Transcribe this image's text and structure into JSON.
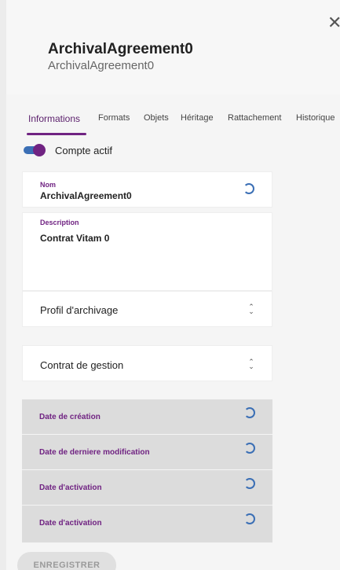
{
  "header": {
    "title": "ArchivalAgreement0",
    "subtitle": "ArchivalAgreement0"
  },
  "tabs": [
    {
      "label": "Informations"
    },
    {
      "label": "Formats"
    },
    {
      "label": "Objets"
    },
    {
      "label": "Héritage"
    },
    {
      "label": "Rattachement"
    },
    {
      "label": "Historique"
    }
  ],
  "active_toggle": {
    "label": "Compte actif",
    "on": true
  },
  "fields": {
    "nom": {
      "label": "Nom",
      "value": "ArchivalAgreement0"
    },
    "description": {
      "label": "Description",
      "value": "Contrat Vitam 0"
    },
    "profil": {
      "label": "Profil d'archivage"
    },
    "contrat": {
      "label": "Contrat de gestion"
    }
  },
  "dates": [
    {
      "label": "Date de création"
    },
    {
      "label": "Date de derniere modification"
    },
    {
      "label": "Date d'activation"
    },
    {
      "label": "Date d'activation"
    }
  ],
  "actions": {
    "save_label": "ENREGISTRER"
  },
  "colors": {
    "accent": "#702382",
    "toggle_track": "#3b6fb5",
    "spinner": "#3b6fb5"
  },
  "icons": {
    "close": "close-icon",
    "spinner": "spinner-icon",
    "chevrons": "chevron-updown-icon"
  }
}
